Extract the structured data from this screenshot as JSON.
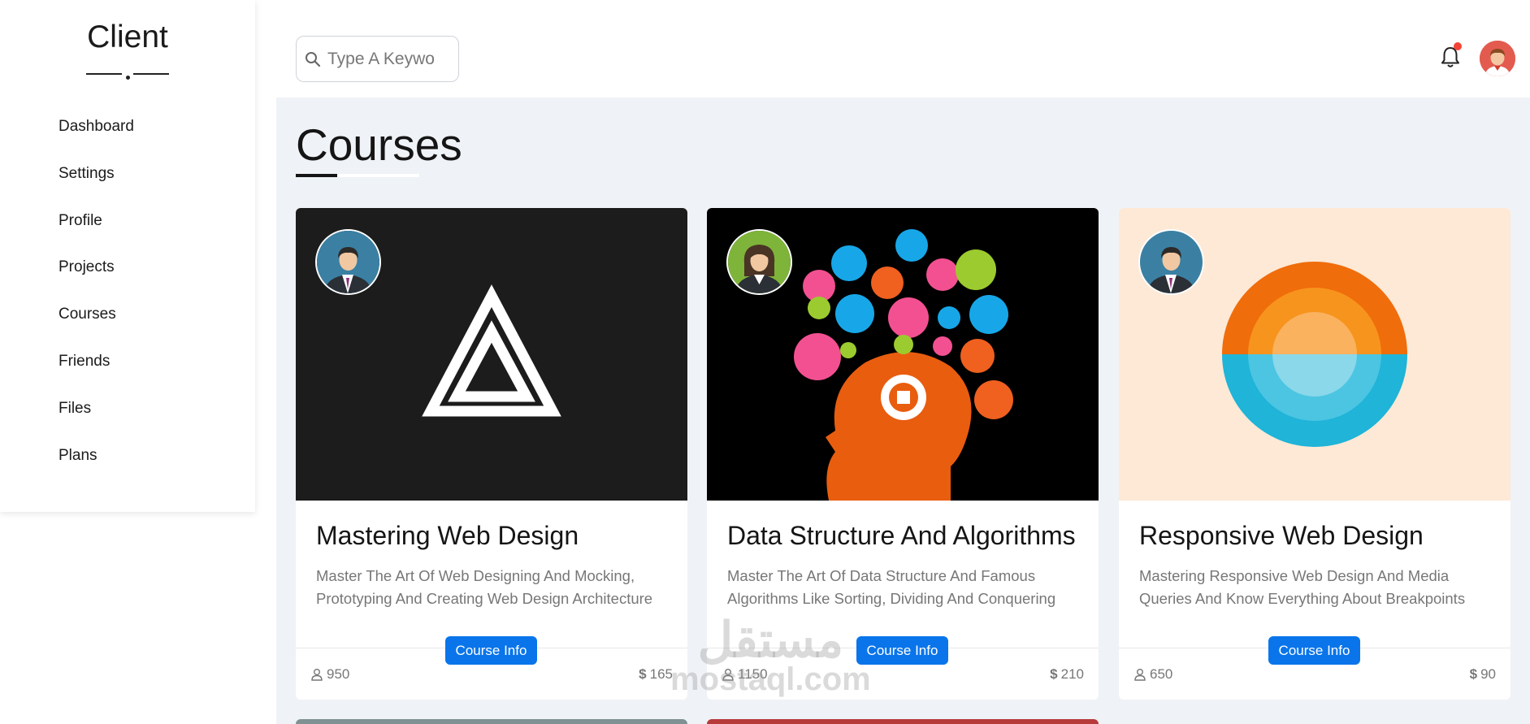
{
  "sidebar": {
    "brand": "Client",
    "items": [
      {
        "label": "Dashboard"
      },
      {
        "label": "Settings"
      },
      {
        "label": "Profile"
      },
      {
        "label": "Projects"
      },
      {
        "label": "Courses"
      },
      {
        "label": "Friends"
      },
      {
        "label": "Files"
      },
      {
        "label": "Plans"
      }
    ]
  },
  "header": {
    "search_placeholder": "Type A Keywo",
    "search_icon": "search-icon",
    "notification_icon": "bell-icon",
    "has_unread_notification": true,
    "badge_color": "#f44336"
  },
  "main": {
    "title": "Courses",
    "courses": [
      {
        "title": "Mastering Web Design",
        "description": "Master The Art Of Web Designing And Mocking, Prototyping And Creating Web Design Architecture",
        "button": "Course Info",
        "students": "950",
        "price": "165",
        "currency": "$"
      },
      {
        "title": "Data Structure And Algorithms",
        "description": "Master The Art Of Data Structure And Famous Algorithms Like Sorting, Dividing And Conquering",
        "button": "Course Info",
        "students": "1150",
        "price": "210",
        "currency": "$"
      },
      {
        "title": "Responsive Web Design",
        "description": "Mastering Responsive Web Design And Media Queries And Know Everything About Breakpoints",
        "button": "Course Info",
        "students": "650",
        "price": "90",
        "currency": "$"
      }
    ]
  },
  "watermark": {
    "arabic": "مستقل",
    "latin": "mostaql.com"
  },
  "colors": {
    "accent": "#0a75ea",
    "background": "#eff2f6"
  }
}
